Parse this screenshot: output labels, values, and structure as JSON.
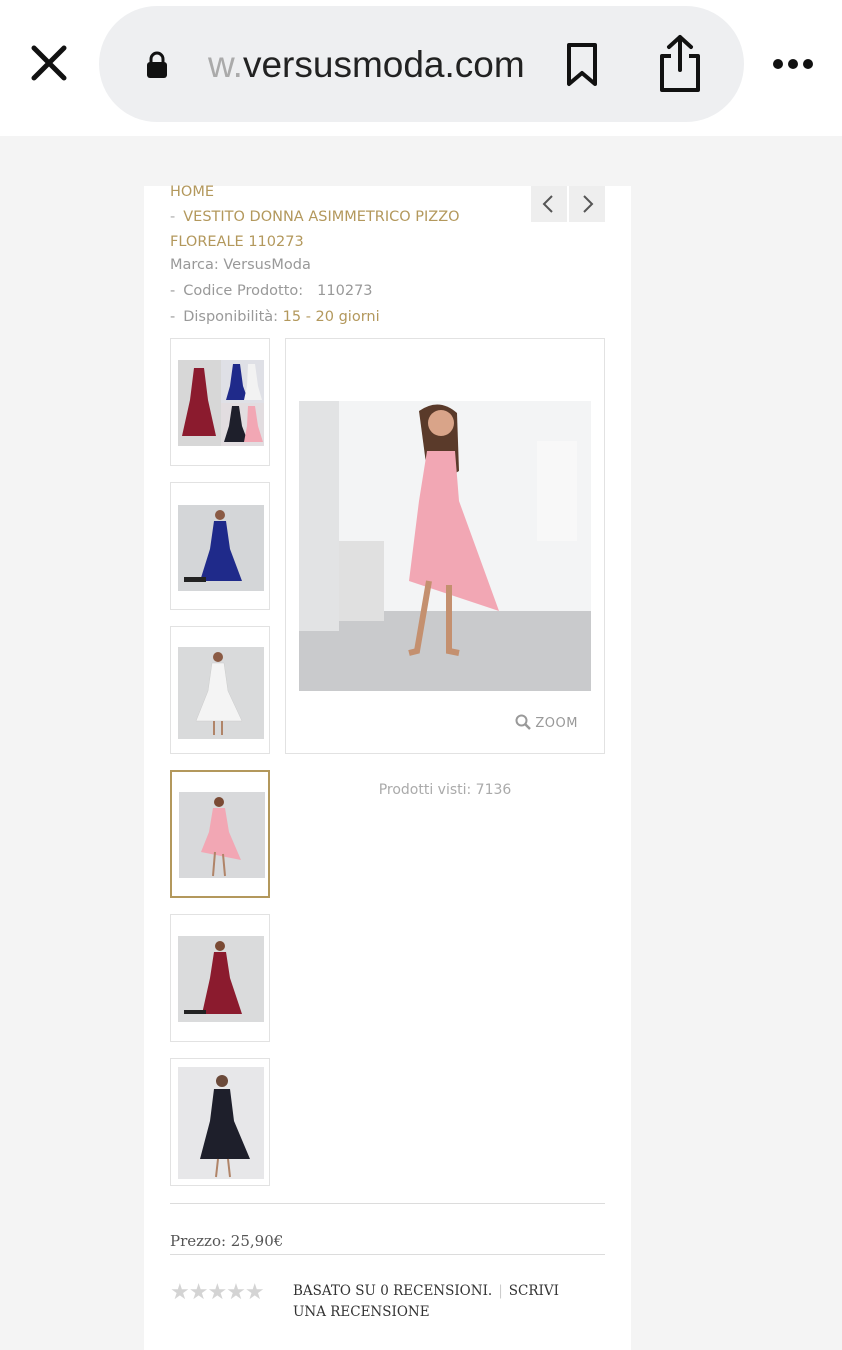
{
  "browser": {
    "url_faded": "w.",
    "url_main": "versusmoda.com",
    "close_icon": "close-icon",
    "lock_icon": "lock-icon",
    "bookmark_icon": "bookmark-icon",
    "share_icon": "share-icon",
    "more_icon": "more-icon"
  },
  "breadcrumb": {
    "home": "HOME",
    "dash": "-",
    "product_line1": "VESTITO DONNA ASIMMETRICO PIZZO",
    "product_line2": "FLOREALE 110273"
  },
  "product": {
    "brand_label": "Marca: VersusModa",
    "code_label": "Codice Prodotto:",
    "code_value": "110273",
    "availability_label": "Disponibilità:",
    "availability_value": "15 - 20 giorni",
    "zoom_label": "ZOOM",
    "views_label": "Prodotti visti: 7136",
    "price_label": "Prezzo: 25,90€",
    "stars": "★★★★★",
    "rating": 0,
    "reviews_label": "BASATO SU 0 RECENSIONI.",
    "separator": "|",
    "write_review_label": "SCRIVI UNA RECENSIONE"
  },
  "thumbnails": [
    {
      "name": "thumb-collage",
      "active": false
    },
    {
      "name": "thumb-blue-dress",
      "active": false
    },
    {
      "name": "thumb-white-dress",
      "active": false
    },
    {
      "name": "thumb-pink-dress",
      "active": true
    },
    {
      "name": "thumb-burgundy-dress",
      "active": false
    },
    {
      "name": "thumb-black-dress",
      "active": false
    }
  ],
  "colors": {
    "accent": "#b3985c",
    "pink_dress": "#f2a7b4",
    "blue_dress": "#1f2a8a",
    "burgundy_dress": "#8b1b2e",
    "black_dress": "#1e1f2b"
  }
}
